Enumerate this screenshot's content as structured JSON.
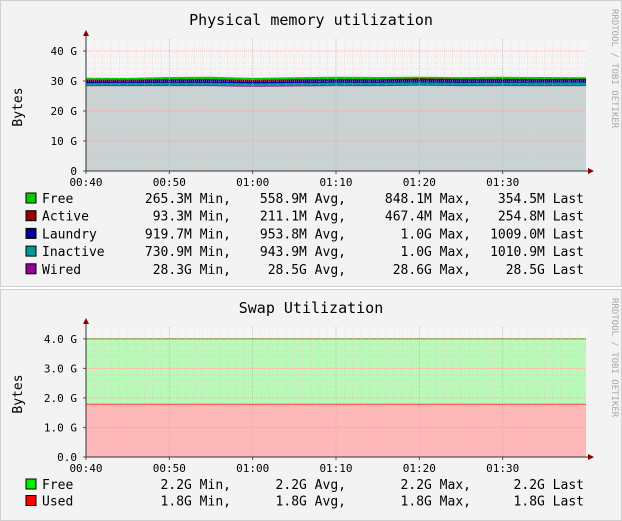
{
  "watermark": "RRDTOOL / TOBI OETIKER",
  "chart_data": [
    {
      "type": "area",
      "title": "Physical memory utilization",
      "ylabel": "Bytes",
      "x_ticks": [
        "00:40",
        "00:50",
        "01:00",
        "01:10",
        "01:20",
        "01:30"
      ],
      "y_ticks": [
        "0",
        "10 G",
        "20 G",
        "30 G",
        "40 G"
      ],
      "ylim": [
        0,
        44
      ],
      "y_unit": "G",
      "x": [
        "00:40",
        "00:45",
        "00:50",
        "00:55",
        "01:00",
        "01:05",
        "01:10",
        "01:15",
        "01:20",
        "01:25",
        "01:30",
        "01:35",
        "01:40"
      ],
      "stack_order": [
        "Wired",
        "Inactive",
        "Laundry",
        "Active",
        "Free"
      ],
      "series": [
        {
          "name": "Free",
          "color": "#00cc00",
          "min": "265.3M",
          "avg": "558.9M",
          "max": "848.1M",
          "last": "354.5M",
          "values": [
            0.45,
            0.4,
            0.55,
            0.6,
            0.5,
            0.52,
            0.58,
            0.55,
            0.35,
            0.4,
            0.5,
            0.45,
            0.35
          ]
        },
        {
          "name": "Active",
          "color": "#990000",
          "min": "93.3M",
          "avg": "211.1M",
          "max": "467.4M",
          "last": "254.8M",
          "values": [
            0.2,
            0.15,
            0.25,
            0.2,
            0.18,
            0.22,
            0.2,
            0.2,
            0.4,
            0.3,
            0.25,
            0.2,
            0.25
          ]
        },
        {
          "name": "Laundry",
          "color": "#000099",
          "min": "919.7M",
          "avg": "953.8M",
          "max": "1.0G",
          "last": "1009.0M",
          "values": [
            0.95,
            0.95,
            0.95,
            0.95,
            0.95,
            0.96,
            0.96,
            0.95,
            0.95,
            0.96,
            0.97,
            0.98,
            0.98
          ]
        },
        {
          "name": "Inactive",
          "color": "#009999",
          "min": "730.9M",
          "avg": "943.9M",
          "max": "1.0G",
          "last": "1010.9M",
          "values": [
            0.8,
            0.85,
            0.9,
            0.95,
            0.9,
            0.95,
            0.98,
            0.95,
            0.92,
            0.95,
            0.98,
            1.0,
            0.99
          ]
        },
        {
          "name": "Wired",
          "color": "#990099",
          "min": "28.3G",
          "avg": "28.5G",
          "max": "28.6G",
          "last": "28.5G",
          "values": [
            28.5,
            28.5,
            28.5,
            28.5,
            28.3,
            28.4,
            28.5,
            28.5,
            28.6,
            28.5,
            28.5,
            28.5,
            28.5
          ]
        }
      ],
      "legend_units": {
        "min": "Min,",
        "avg": "Avg,",
        "max": "Max,",
        "last": "Last"
      }
    },
    {
      "type": "area",
      "title": "Swap Utilization",
      "ylabel": "Bytes",
      "x_ticks": [
        "00:40",
        "00:50",
        "01:00",
        "01:10",
        "01:20",
        "01:30"
      ],
      "y_ticks": [
        "0.0",
        "1.0 G",
        "2.0 G",
        "3.0 G",
        "4.0 G"
      ],
      "ylim": [
        0,
        4.4
      ],
      "y_unit": "G",
      "x": [
        "00:40",
        "01:40"
      ],
      "stack_order": [
        "Used",
        "Free"
      ],
      "series": [
        {
          "name": "Free",
          "color": "#00ee00",
          "min": "2.2G",
          "avg": "2.2G",
          "max": "2.2G",
          "last": "2.2G",
          "values": [
            2.2,
            2.2
          ]
        },
        {
          "name": "Used",
          "color": "#ff0000",
          "min": "1.8G",
          "avg": "1.8G",
          "max": "1.8G",
          "last": "1.8G",
          "values": [
            1.8,
            1.8
          ]
        }
      ],
      "legend_units": {
        "min": "Min,",
        "avg": "Avg,",
        "max": "Max,",
        "last": "Last"
      }
    }
  ]
}
